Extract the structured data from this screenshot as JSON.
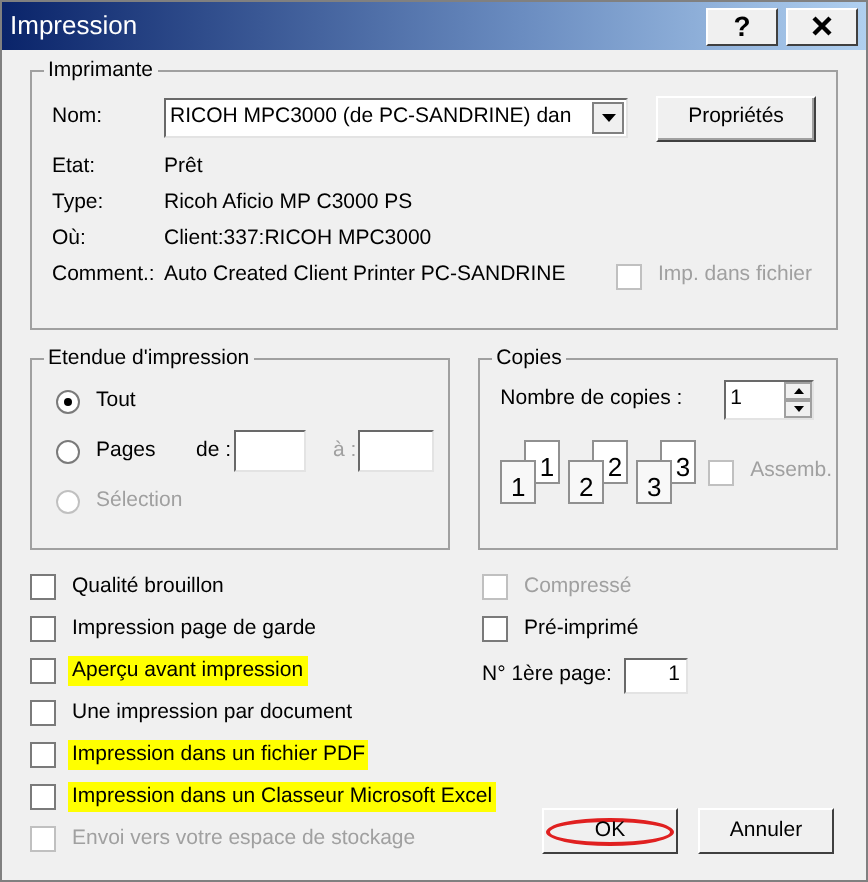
{
  "window": {
    "title": "Impression",
    "help": "?"
  },
  "printer": {
    "legend": "Imprimante",
    "name_label": "Nom:",
    "name_value": "RICOH MPC3000 (de PC-SANDRINE) dan",
    "properties_button": "Propriétés",
    "info": [
      {
        "label": "Etat:",
        "value": "Prêt"
      },
      {
        "label": "Type:",
        "value": "Ricoh Aficio MP C3000 PS"
      },
      {
        "label": "Où:",
        "value": "Client:337:RICOH MPC3000"
      },
      {
        "label": "Comment.:",
        "value": "Auto Created Client Printer PC-SANDRINE"
      }
    ],
    "print_to_file": {
      "label": "Imp. dans fichier",
      "checked": false,
      "disabled": true
    }
  },
  "range": {
    "legend": "Etendue d'impression",
    "options": [
      {
        "label": "Tout",
        "selected": true,
        "disabled": false
      },
      {
        "label": "Pages",
        "selected": false,
        "disabled": false
      },
      {
        "label": "Sélection",
        "selected": false,
        "disabled": true
      }
    ],
    "from_label": "de :",
    "to_label": "à :"
  },
  "copies": {
    "legend": "Copies",
    "count_label": "Nombre de copies :",
    "count": "1",
    "collate_icons": [
      {
        "back": "1",
        "front": "1"
      },
      {
        "back": "2",
        "front": "2"
      },
      {
        "back": "3",
        "front": "3"
      }
    ],
    "collate": {
      "label": "Assemb.",
      "checked": false,
      "disabled": true
    }
  },
  "options_left": [
    {
      "label": "Qualité brouillon",
      "checked": false,
      "disabled": false,
      "highlighted": false
    },
    {
      "label": "Impression page de garde",
      "checked": false,
      "disabled": false,
      "highlighted": false
    },
    {
      "label": "Aperçu avant impression",
      "checked": false,
      "disabled": false,
      "highlighted": true
    },
    {
      "label": "Une impression par document",
      "checked": false,
      "disabled": false,
      "highlighted": false
    },
    {
      "label": "Impression dans un fichier PDF",
      "checked": false,
      "disabled": false,
      "highlighted": true
    },
    {
      "label": "Impression dans un Classeur Microsoft Excel",
      "checked": false,
      "disabled": false,
      "highlighted": true
    },
    {
      "label": "Envoi vers votre espace de stockage",
      "checked": false,
      "disabled": true,
      "highlighted": false
    }
  ],
  "options_right": [
    {
      "kind": "checkbox",
      "label": "Compressé",
      "checked": false,
      "disabled": true
    },
    {
      "kind": "checkbox",
      "label": "Pré-imprimé",
      "checked": false,
      "disabled": false
    },
    {
      "kind": "field",
      "label": "N° 1ère page:",
      "value": "1"
    }
  ],
  "buttons": {
    "ok": {
      "label": "OK",
      "circled": true
    },
    "cancel": {
      "label": "Annuler"
    }
  }
}
